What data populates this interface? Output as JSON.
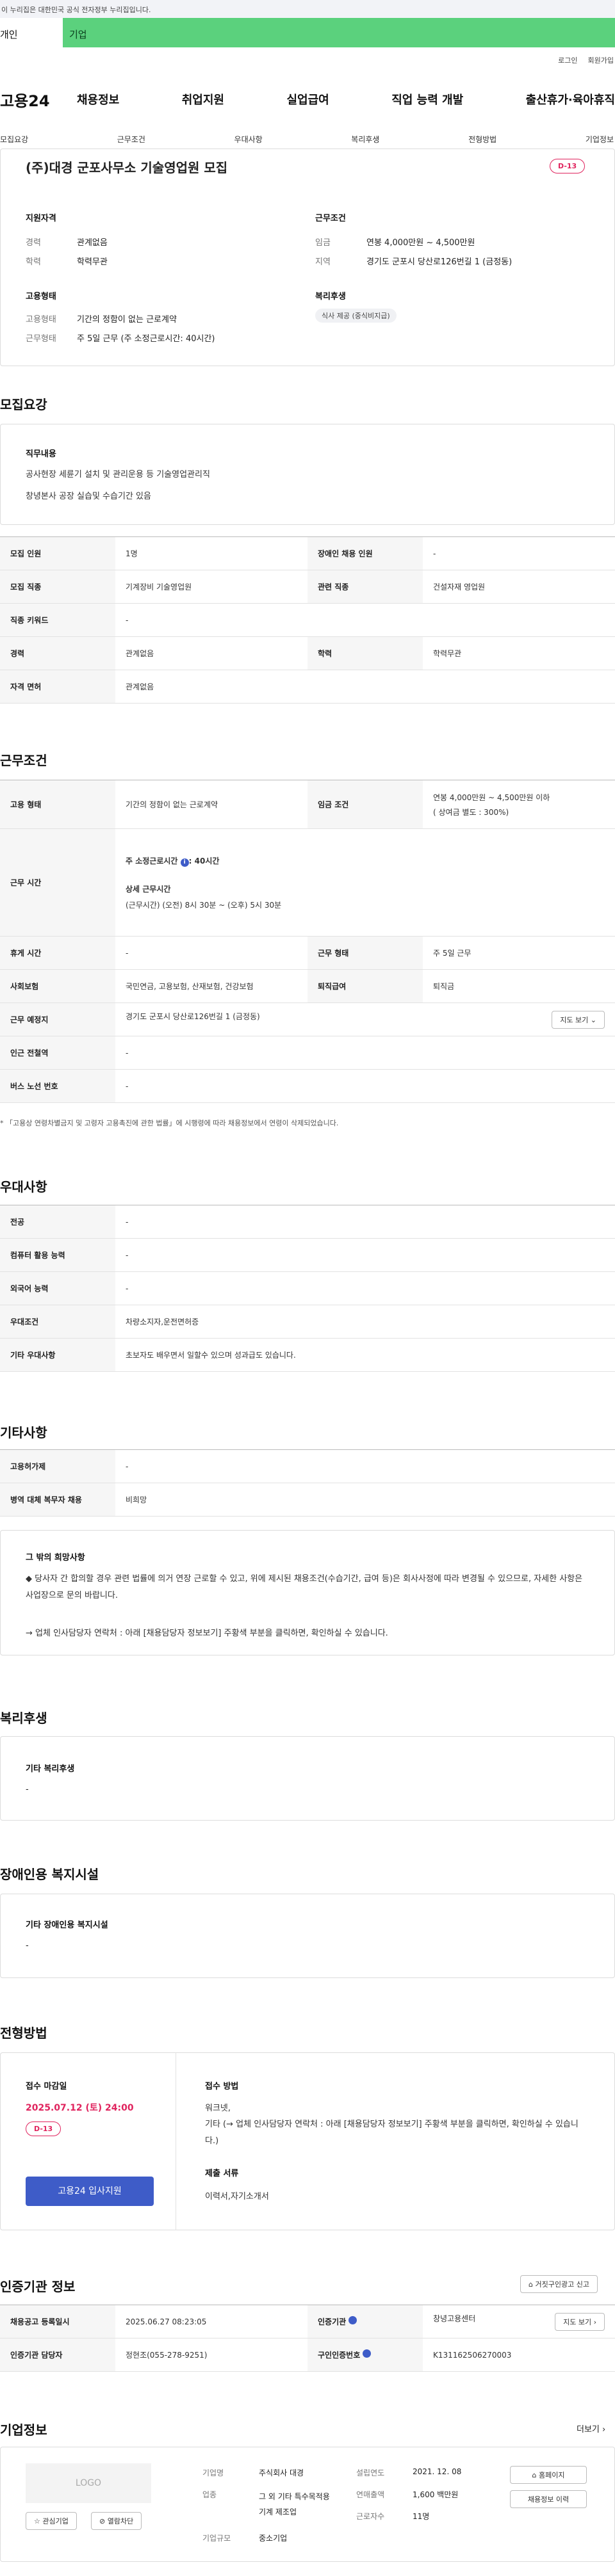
{
  "gov_notice": "이 누리집은 대한민국 공식 전자정부 누리집입니다.",
  "top_tabs": {
    "individual": "개인",
    "business": "기업"
  },
  "util": {
    "login": "로그인",
    "signup": "회원가입"
  },
  "logo": "고용24",
  "gnb": [
    "채용정보",
    "취업지원",
    "실업급여",
    "직업 능력 개발",
    "출산휴가·육아휴직"
  ],
  "subnav": [
    "모집요강",
    "근무조건",
    "우대사항",
    "복리후생",
    "전형방법",
    "기업정보"
  ],
  "summary": {
    "title": "(주)대경 군포사무소 기술영업원 모집",
    "dday": "D-13",
    "qual_h": "지원자격",
    "career_k": "경력",
    "career_v": "관계없음",
    "edu_k": "학력",
    "edu_v": "학력무관",
    "cond_h": "근무조건",
    "wage_k": "임금",
    "wage_v": "연봉 4,000만원 ~ 4,500만원",
    "area_k": "지역",
    "area_v": "경기도 군포시 당산로126번길 1 (금정동)",
    "emp_h": "고용형태",
    "emptype_k": "고용형태",
    "emptype_v": "기간의 정함이 없는 근로계약",
    "worktype_k": "근무형태",
    "worktype_v": "주 5일 근무 (주 소정근로시간: 40시간)",
    "welfare_h": "복리후생",
    "welfare_tag": "식사 제공 (중식비지급)"
  },
  "recruit": {
    "heading": "모집요강",
    "job_h": "직무내용",
    "job_lines": [
      "공사현장 세륜기 설치 및 관리운용 등 기술영업관리직",
      "창녕본사 공장 실습및 수습기간 있음"
    ],
    "rows": [
      [
        "모집 인원",
        "1명",
        "장애인 채용 인원",
        "-"
      ],
      [
        "모집 직종",
        "기계장비 기술영업원",
        "관련 직종",
        "건설자재 영업원"
      ],
      [
        "직종 키워드",
        "-",
        "",
        ""
      ],
      [
        "경력",
        "관계없음",
        "학력",
        "학력무관"
      ],
      [
        "자격 면허",
        "관계없음",
        "",
        ""
      ]
    ]
  },
  "work": {
    "heading": "근무조건",
    "emp_k": "고용 형태",
    "emp_v": "기간의 정함이 없는 근로계약",
    "wage_k": "임금 조건",
    "wage_v1": "연봉 4,000만원 ~ 4,500만원 이하",
    "wage_v2": "( 상여금 별도 : 300%)",
    "hours_k": "근무 시간",
    "hours_h": "주 소정근로시간 ",
    "hours_info": "i",
    "hours_v": ": 40시간",
    "detail_h": "상세 근무시간",
    "detail_v": "(근무시간) (오전) 8시 30분 ~ (오후) 5시 30분",
    "holiday_k": "휴게 시간",
    "holiday_v": "-",
    "form_k": "근무 형태",
    "form_v": "주 5일 근무",
    "ins_k": "사회보험",
    "ins_v": "국민연금, 고용보험, 산재보험, 건강보험",
    "sev_k": "퇴직급여",
    "sev_v": "퇴직금",
    "place_k": "근무 예정지",
    "place_v": "경기도 군포시 당산로126번길 1 (금정동)",
    "map_btn": "지도 보기",
    "subway_k": "인근 전철역",
    "subway_v": "-",
    "bus_k": "버스 노선 번호",
    "bus_v": "-",
    "note": "* 「고용상 연령차별금지 및 고령자 고용촉진에 관한 법률」에 시행령에 따라 채용정보에서 연령이 삭제되었습니다."
  },
  "pref": {
    "heading": "우대사항",
    "rows": [
      [
        "전공",
        "-"
      ],
      [
        "컴퓨터 활용 능력",
        "-"
      ],
      [
        "외국어 능력",
        "-"
      ],
      [
        "우대조건",
        "차량소지자,운전면허증"
      ],
      [
        "기타 우대사항",
        "초보자도 배우면서 일할수  있으며 성과급도 있습니다."
      ]
    ]
  },
  "etc": {
    "heading": "기타사항",
    "rows": [
      [
        "고용허가제",
        "-"
      ],
      [
        "병역 대체 복무자 채용",
        "비희망"
      ]
    ],
    "box_h": "그 밖의 희망사항",
    "box_l1": "◆ 당사자 간 합의할 경우 관련 법률에 의거 연장 근로할 수 있고, 위에 제시된 채용조건(수습기간, 급여 등)은 회사사정에 따라 변경될 수 있으므로, 자세한 사항은 사업장으로 문의 바랍니다.",
    "box_l2": "→ 업체 인사담당자 연락처 : 아래 [채용담당자 정보보기] 주황색 부분을 클릭하면, 확인하실 수 있습니다."
  },
  "welfare": {
    "heading": "복리후생",
    "h": "기타 복리후생",
    "v": "-"
  },
  "disabled": {
    "heading": "장애인용 복지시설",
    "h": "기타 장애인용 복지시설",
    "v": "-"
  },
  "process": {
    "heading": "전형방법",
    "deadline_h": "접수 마감일",
    "deadline_v": "2025.07.12 (토) 24:00",
    "dday": "D-13",
    "apply_btn": "고용24 입사지원",
    "method_h": "접수 방법",
    "method_v1": "워크넷,",
    "method_v2": "기타 (→ 업체 인사담당자 연락처 : 아래 [채용담당자 정보보기] 주황색 부분을 클릭하면, 확인하실 수 있습니다.)",
    "docs_h": "제출 서류",
    "docs_v": "이력서,자기소개서"
  },
  "agency": {
    "heading": "인증기관 정보",
    "report_btn": "거짓구인광고 신고",
    "reg_k": "채용공고 등록일시",
    "reg_v": "2025.06.27 08:23:05",
    "org_k": "인증기관",
    "org_v": "창녕고용센터",
    "map_btn": "지도 보기",
    "mgr_k": "인증기관 담당자",
    "mgr_v": "정현조(055-278-9251)",
    "no_k": "구인인증번호",
    "no_v": "K131162506270003"
  },
  "company": {
    "heading": "기업정보",
    "more": "더보기",
    "logo_ph": "LOGO",
    "fav_btn": "관심기업",
    "block_btn": "열람차단",
    "name_k": "기업명",
    "name_v": "주식회사 대경",
    "ind_k": "업종",
    "ind_v": "그 외 기타 특수목적용 기계 제조업",
    "size_k": "기업규모",
    "size_v": "중소기업",
    "est_k": "설립연도",
    "est_v": "2021. 12. 08",
    "sales_k": "연매출액",
    "sales_v": "1,600 백만원",
    "emp_k": "근로자수",
    "emp_v": "11명",
    "home_btn": "홈페이지",
    "hist_btn": "채용정보 이력"
  },
  "colors": {
    "accent": "#3e5cc8",
    "dday": "#e0245e",
    "biz_tab": "#5bd17d"
  }
}
